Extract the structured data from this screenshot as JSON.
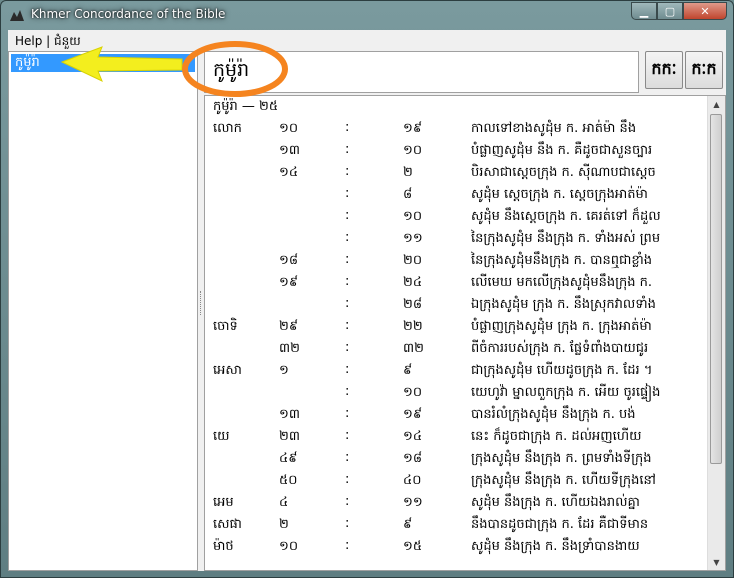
{
  "window": {
    "title": "Khmer Concordance of the Bible",
    "minimize": "▁",
    "maximize": "▢",
    "close": "✕"
  },
  "menu": {
    "help": "Help | ជំនួយ"
  },
  "left_list": {
    "items": [
      "កូម៉ូរ៉ា"
    ]
  },
  "search": {
    "value": "កូម៉ូរ៉ា"
  },
  "buttons": {
    "k_left": "កកៈ",
    "k_right": "កៈក"
  },
  "results": {
    "header": "កូម៉ូរ៉ា — ២៥",
    "separator": ":",
    "rows": [
      {
        "book": "លោក",
        "ch": "១០",
        "v": "១៩",
        "text": "កាលទៅខាងសូដុំម ក. អាត់ម៉ា នឹង"
      },
      {
        "book": "",
        "ch": "១៣",
        "v": "១០",
        "text": "បំផ្លាញសូដុំម នឹង ក. គឺដូចជាសួនច្បារ"
      },
      {
        "book": "",
        "ch": "១៤",
        "v": "២",
        "text": "បិរសាជាស្តេចក្រុង ក. ស៊ីណាបជាស្តេច"
      },
      {
        "book": "",
        "ch": "",
        "v": "៨",
        "text": "សូដុំម ស្តេចក្រុង ក. ស្តេចក្រុងអាត់ម៉ា"
      },
      {
        "book": "",
        "ch": "",
        "v": "១០",
        "text": "សូដុំម នឹងស្តេចក្រុង ក. គេរត់ទៅ ក៏ដួល"
      },
      {
        "book": "",
        "ch": "",
        "v": "១១",
        "text": "នៃក្រុងសូដុំម នឹងក្រុង ក. ទាំងអស់ ព្រម"
      },
      {
        "book": "",
        "ch": "១៨",
        "v": "២០",
        "text": "នៃក្រុងសូដុំមនឹងក្រុង ក. បានឮជាខ្លាំង"
      },
      {
        "book": "",
        "ch": "១៩",
        "v": "២៤",
        "text": "លើមេឃ មកលើក្រុងសូដុំមនឹងក្រុង ក."
      },
      {
        "book": "",
        "ch": "",
        "v": "២៨",
        "text": "ឯក្រុងសូដុំម ក្រុង ក. នឹងស្រុកវាលទាំង"
      },
      {
        "book": "ចោទិ",
        "ch": "២៩",
        "v": "២២",
        "text": "បំផ្លាញក្រុងសូដុំម ក្រុង ក. ក្រុងអាត់ម៉ា"
      },
      {
        "book": "",
        "ch": "៣២",
        "v": "៣២",
        "text": "ពីចំការរបស់ក្រុង ក. ផ្លែទំពាំងបាយជូរ"
      },
      {
        "book": "អេសា",
        "ch": "១",
        "v": "៩",
        "text": "ជាក្រុងសូដុំម ហើយដូចក្រុង ក. ដែរ ។"
      },
      {
        "book": "",
        "ch": "",
        "v": "១០",
        "text": "យេហូវ៉ា ម្នាលពួកក្រុង ក. អើយ ចូរផ្ទៀង"
      },
      {
        "book": "",
        "ch": "១៣",
        "v": "១៩",
        "text": "បានរំលំក្រុងសូដុំម នឹងក្រុង ក. បង់"
      },
      {
        "book": "យេ",
        "ch": "២៣",
        "v": "១៤",
        "text": "នេះ ក៏ដូចជាក្រុង ក. ដល់អញហើយ"
      },
      {
        "book": "",
        "ch": "៤៩",
        "v": "១៨",
        "text": "ក្រុងសូដុំម នឹងក្រុង ក. ព្រមទាំងទីក្រុង"
      },
      {
        "book": "",
        "ch": "៥០",
        "v": "៤០",
        "text": "ក្រុងសូដុំម នឹងក្រុង ក. ហើយទីក្រុងនៅ"
      },
      {
        "book": "អេម",
        "ch": "៤",
        "v": "១១",
        "text": "សូដុំម នឹងក្រុង ក. ហើយឯងរាល់គ្នា"
      },
      {
        "book": "សេផា",
        "ch": "២",
        "v": "៩",
        "text": "នឹងបានដូចជាក្រុង ក. ដែរ គឺជាទីមាន"
      },
      {
        "book": "ម៉ាថ",
        "ch": "១០",
        "v": "១៥",
        "text": "សូដុំម នឹងក្រុង ក. នឹងទ្រាំបានងាយ"
      }
    ]
  },
  "colors": {
    "selection": "#3399ff",
    "annotation_orange": "#f5841f",
    "annotation_yellow": "#f3ee1e"
  }
}
